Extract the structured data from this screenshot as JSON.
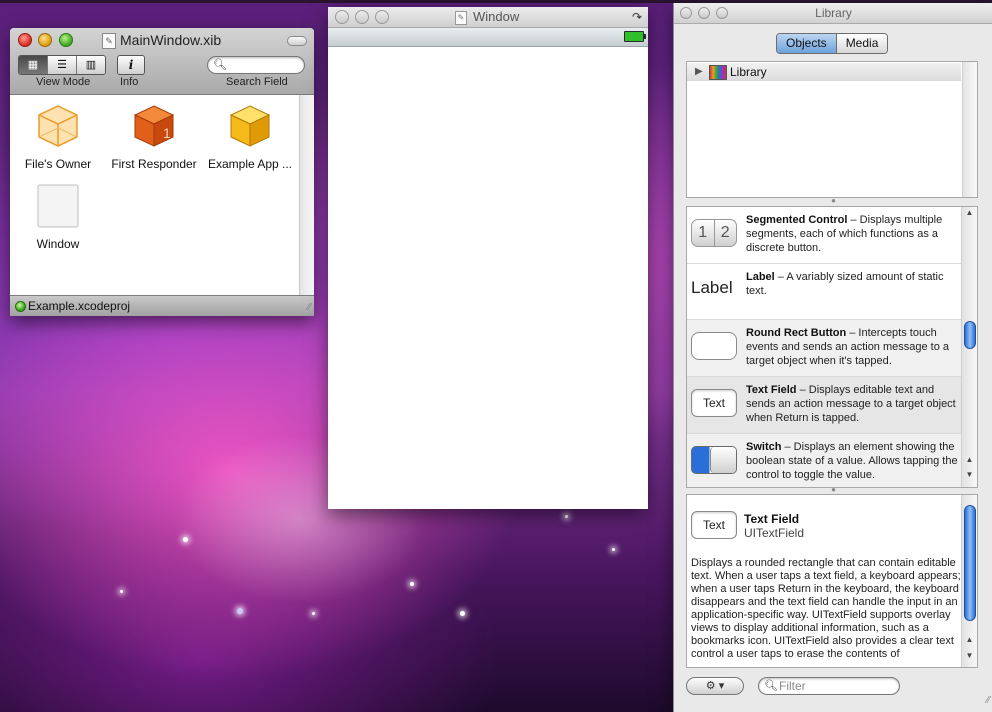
{
  "xib_window": {
    "title": "MainWindow.xib",
    "toolbar": {
      "view_mode_label": "View Mode",
      "info_label": "Info",
      "search_label": "Search Field"
    },
    "objects": [
      {
        "label": "File's Owner",
        "icon": "file-owner-cube-icon"
      },
      {
        "label": "First Responder",
        "icon": "first-responder-cube-icon"
      },
      {
        "label": "Example App ...",
        "icon": "app-delegate-cube-icon"
      },
      {
        "label": "Window",
        "icon": "window-object-icon"
      }
    ],
    "status": "Example.xcodeproj"
  },
  "sim_window": {
    "title": "Window"
  },
  "library": {
    "title": "Library",
    "tabs": [
      "Objects",
      "Media"
    ],
    "selected_tab": "Objects",
    "tree_root": "Library",
    "items": [
      {
        "name": "Segmented Control",
        "desc": " – Displays multiple segments, each of which functions as a discrete button.",
        "thumb_text": [
          "1",
          "2"
        ]
      },
      {
        "name": "Label",
        "desc": " – A variably sized amount of static text.",
        "thumb_text": "Label"
      },
      {
        "name": "Round Rect Button",
        "desc": " – Intercepts touch events and sends an action message to a target object when it's tapped.",
        "thumb_text": ""
      },
      {
        "name": "Text Field",
        "desc": " – Displays editable text and sends an action message to a target object when Return is tapped.",
        "thumb_text": "Text"
      },
      {
        "name": "Switch",
        "desc": " – Displays an element showing the boolean state of a value. Allows tapping the control to toggle the value.",
        "thumb_text": ""
      }
    ],
    "detail": {
      "title": "Text Field",
      "class": "UITextField",
      "thumb_text": "Text",
      "body": "Displays a rounded rectangle that can contain editable text. When a user taps a text field, a keyboard appears; when a user taps Return in the keyboard, the keyboard disappears and the text field can handle the input in an application-specific way. UITextField supports overlay views to display additional information, such as a bookmarks icon. UITextField also provides a clear text control a user taps to erase the contents of"
    },
    "filter_placeholder": "Filter"
  }
}
